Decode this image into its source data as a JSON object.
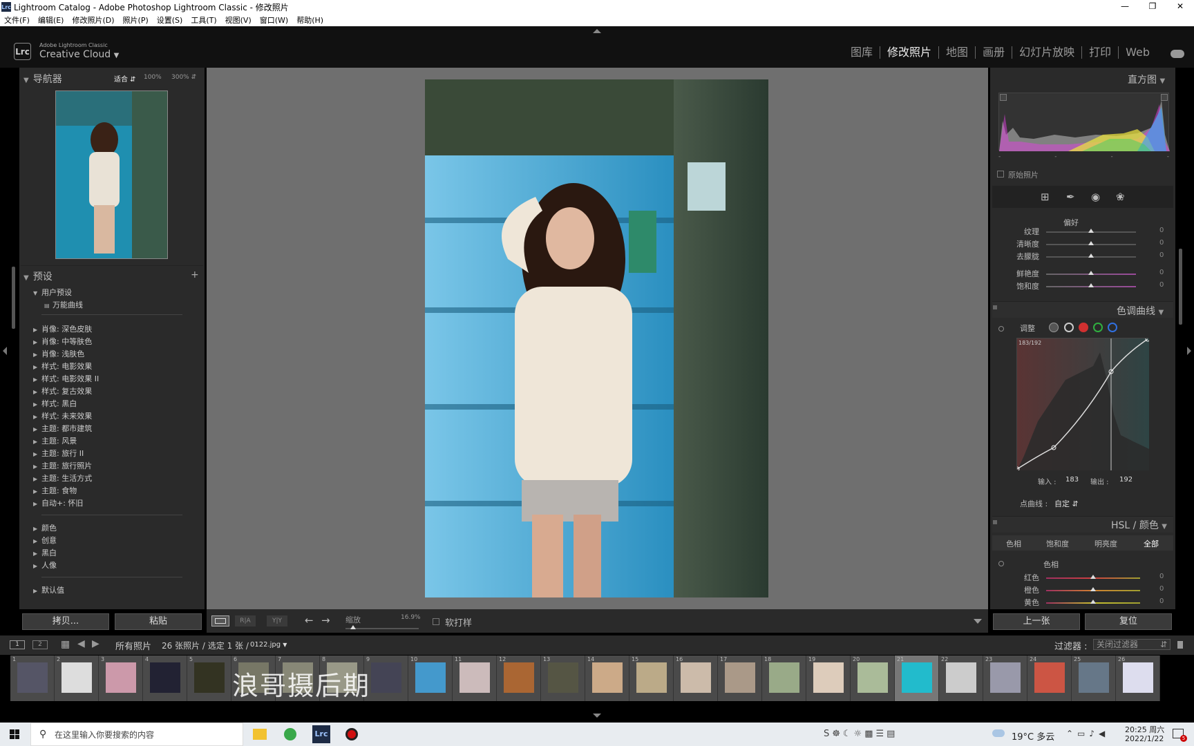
{
  "window": {
    "title": "Lightroom Catalog - Adobe Photoshop Lightroom Classic - 修改照片",
    "app_icon": "Lrc"
  },
  "menu": [
    "文件(F)",
    "编辑(E)",
    "修改照片(D)",
    "照片(P)",
    "设置(S)",
    "工具(T)",
    "视图(V)",
    "窗口(W)",
    "帮助(H)"
  ],
  "brand": {
    "small": "Adobe Lightroom Classic",
    "big": "Creative Cloud",
    "logo": "Lrc"
  },
  "modules": [
    "图库",
    "修改照片",
    "地图",
    "画册",
    "幻灯片放映",
    "打印",
    "Web"
  ],
  "navigator": {
    "title": "导航器",
    "zoom_fit": "适合",
    "zoom_100": "100%",
    "zoom_300": "300%"
  },
  "presets": {
    "title": "预设",
    "add": "+",
    "user_group": "用户预设",
    "user_items": [
      "万能曲线"
    ],
    "groups": [
      "肖像: 深色皮肤",
      "肖像: 中等肤色",
      "肖像: 浅肤色",
      "样式: 电影效果",
      "样式: 电影效果 II",
      "样式: 复古效果",
      "样式: 黑白",
      "样式: 未来效果",
      "主题: 都市建筑",
      "主题: 风景",
      "主题: 旅行 II",
      "主题: 旅行照片",
      "主题: 生活方式",
      "主题: 食物",
      "自动+: 怀旧"
    ],
    "groups2": [
      "颜色",
      "创意",
      "黑白",
      "人像"
    ],
    "default": "默认值"
  },
  "left_buttons": {
    "copy": "拷贝...",
    "paste": "粘贴"
  },
  "toolbar": {
    "zoom_label": "缩放",
    "zoom_value": "16.9%",
    "proof": "软打样",
    "ry": "Y|Y",
    "ra": "R|A"
  },
  "histogram": {
    "title": "直方图",
    "original": "原始照片",
    "dashes": [
      "-",
      "-",
      "-",
      "-"
    ]
  },
  "presence": {
    "title": "偏好",
    "sliders": [
      {
        "label": "纹理",
        "value": "0"
      },
      {
        "label": "清晰度",
        "value": "0"
      },
      {
        "label": "去朦胧",
        "value": "0"
      },
      {
        "label": "鲜艳度",
        "value": "0"
      },
      {
        "label": "饱和度",
        "value": "0"
      }
    ]
  },
  "tone_curve": {
    "title": "色调曲线",
    "adjust": "调整",
    "readout": "183/192",
    "input_label": "输入 :",
    "input_value": "183",
    "output_label": "输出 :",
    "output_value": "192",
    "point_curve_label": "点曲线 :",
    "point_curve_value": "自定"
  },
  "hsl": {
    "title": "HSL / 颜色",
    "tabs": [
      "色相",
      "饱和度",
      "明亮度",
      "全部"
    ],
    "section": "色相",
    "sliders": [
      {
        "label": "红色",
        "value": "0",
        "color": "#d04040"
      },
      {
        "label": "橙色",
        "value": "0",
        "color": "#d08030"
      },
      {
        "label": "黄色",
        "value": "0",
        "color": "#c8c030"
      }
    ]
  },
  "right_buttons": {
    "prev": "上一张",
    "reset": "复位"
  },
  "filmstrip_bar": {
    "page1": "1",
    "page2": "2",
    "source": "所有照片",
    "count": "26 张照片 / 选定 1 张 /",
    "file": "0122.jpg",
    "filter_label": "过滤器 :",
    "filter_value": "关闭过滤器"
  },
  "thumbnails": [
    {
      "n": "1",
      "c": "#556"
    },
    {
      "n": "2",
      "c": "#ddd"
    },
    {
      "n": "3",
      "c": "#c9a"
    },
    {
      "n": "4",
      "c": "#223"
    },
    {
      "n": "5",
      "c": "#332"
    },
    {
      "n": "6",
      "c": "#776"
    },
    {
      "n": "7",
      "c": "#887"
    },
    {
      "n": "8",
      "c": "#998"
    },
    {
      "n": "9",
      "c": "#445"
    },
    {
      "n": "10",
      "c": "#49c"
    },
    {
      "n": "11",
      "c": "#cbb"
    },
    {
      "n": "12",
      "c": "#a63"
    },
    {
      "n": "13",
      "c": "#554"
    },
    {
      "n": "14",
      "c": "#ca8"
    },
    {
      "n": "15",
      "c": "#ba8"
    },
    {
      "n": "16",
      "c": "#cba"
    },
    {
      "n": "17",
      "c": "#a98"
    },
    {
      "n": "18",
      "c": "#9a8"
    },
    {
      "n": "19",
      "c": "#dcb"
    },
    {
      "n": "20",
      "c": "#ab9"
    },
    {
      "n": "21",
      "c": "#2bc"
    },
    {
      "n": "22",
      "c": "#ccc"
    },
    {
      "n": "23",
      "c": "#99a"
    },
    {
      "n": "24",
      "c": "#c54"
    },
    {
      "n": "25",
      "c": "#678"
    },
    {
      "n": "26",
      "c": "#dde"
    }
  ],
  "watermark": "浪哥摄后期",
  "taskbar": {
    "search_placeholder": "在这里输入你要搜索的内容",
    "weather": "19°C 多云",
    "time": "20:25 周六",
    "date": "2022/1/22",
    "notif": "5"
  },
  "colors": {
    "panel": "#2a2a2a",
    "canvas": "#6f6f6f",
    "accent": "#eee"
  }
}
